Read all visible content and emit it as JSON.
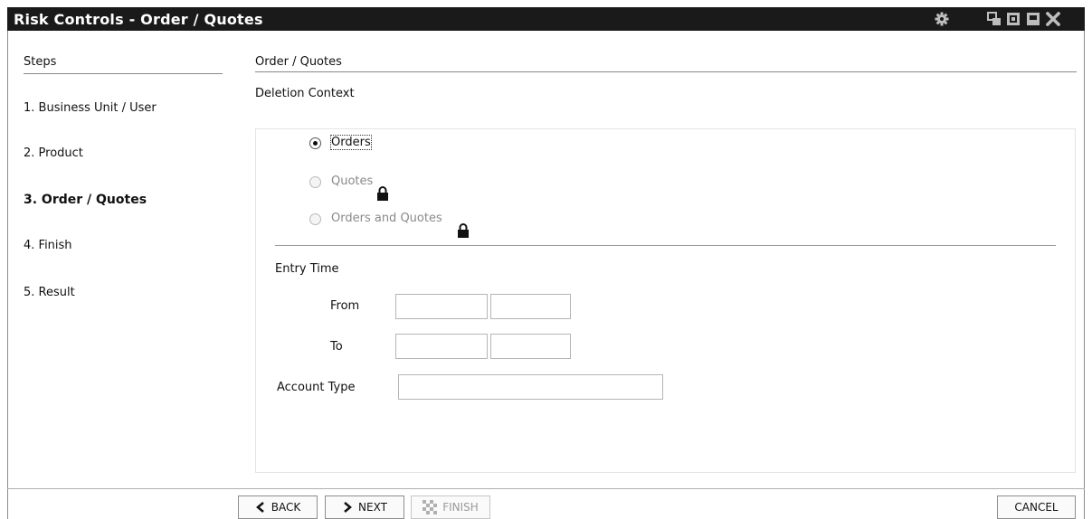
{
  "window": {
    "title": "Risk Controls - Order / Quotes"
  },
  "steps": {
    "header": "Steps",
    "items": [
      {
        "label": "1. Business Unit / User",
        "active": false
      },
      {
        "label": "2. Product",
        "active": false
      },
      {
        "label": "3. Order / Quotes",
        "active": true
      },
      {
        "label": "4. Finish",
        "active": false
      },
      {
        "label": "5. Result",
        "active": false
      }
    ]
  },
  "main": {
    "title": "Order / Quotes",
    "deletion_context_label": "Deletion Context",
    "options": [
      {
        "label": "Orders",
        "selected": true,
        "enabled": true
      },
      {
        "label": "Quotes",
        "selected": false,
        "enabled": false,
        "locked": true
      },
      {
        "label": "Orders and Quotes",
        "selected": false,
        "enabled": false,
        "locked": true
      }
    ],
    "entry_time": {
      "label": "Entry Time",
      "from_label": "From",
      "to_label": "To",
      "from_date": "",
      "from_time": "",
      "to_date": "",
      "to_time": ""
    },
    "account_type": {
      "label": "Account Type",
      "value": ""
    }
  },
  "footer": {
    "back": "BACK",
    "next": "NEXT",
    "finish": "FINISH",
    "cancel": "CANCEL"
  },
  "icons": {
    "title_bar": [
      "gear-icon",
      "restore-icon",
      "pin-icon",
      "maximize-icon",
      "close-icon"
    ],
    "lock": "lock-icon"
  }
}
